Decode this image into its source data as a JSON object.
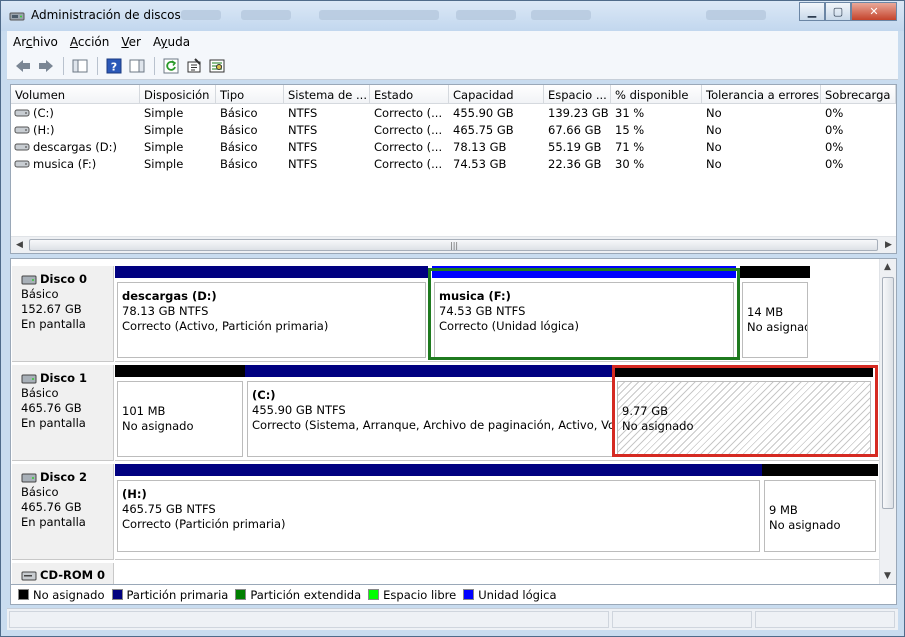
{
  "window": {
    "title": "Administración de discos"
  },
  "menu": [
    {
      "label": "Archivo",
      "accel": "r",
      "pre": "A",
      "post": "chivo"
    },
    {
      "label": "Acción",
      "pre": "",
      "accel": "A",
      "post": "cción"
    },
    {
      "label": "Ver",
      "pre": "",
      "accel": "V",
      "post": "er"
    },
    {
      "label": "Ayuda",
      "pre": "",
      "accel": "A",
      "post": "yuda"
    }
  ],
  "columns": [
    "Volumen",
    "Disposición",
    "Tipo",
    "Sistema de ...",
    "Estado",
    "Capacidad",
    "Espacio ...",
    "% disponible",
    "Tolerancia a errores",
    "Sobrecarga"
  ],
  "volumes": [
    {
      "name": "(C:)",
      "layout": "Simple",
      "type": "Básico",
      "fs": "NTFS",
      "status": "Correcto (...",
      "capacity": "455.90 GB",
      "free": "139.23 GB",
      "pct": "31 %",
      "fault": "No",
      "overhead": "0%"
    },
    {
      "name": "(H:)",
      "layout": "Simple",
      "type": "Básico",
      "fs": "NTFS",
      "status": "Correcto (...",
      "capacity": "465.75 GB",
      "free": "67.66 GB",
      "pct": "15 %",
      "fault": "No",
      "overhead": "0%"
    },
    {
      "name": "descargas (D:)",
      "layout": "Simple",
      "type": "Básico",
      "fs": "NTFS",
      "status": "Correcto (...",
      "capacity": "78.13 GB",
      "free": "55.19 GB",
      "pct": "71 %",
      "fault": "No",
      "overhead": "0%"
    },
    {
      "name": "musica (F:)",
      "layout": "Simple",
      "type": "Básico",
      "fs": "NTFS",
      "status": "Correcto (...",
      "capacity": "74.53 GB",
      "free": "22.36 GB",
      "pct": "30 %",
      "fault": "No",
      "overhead": "0%"
    }
  ],
  "disks": [
    {
      "name": "Disco 0",
      "type": "Básico",
      "size": "152.67 GB",
      "state": "En pantalla",
      "partitions": [
        {
          "title": "descargas  (D:)",
          "line1": "78.13 GB NTFS",
          "line2": "Correcto (Activo, Partición primaria)"
        },
        {
          "title": "musica  (F:)",
          "line1": "74.53 GB NTFS",
          "line2": "Correcto (Unidad lógica)"
        },
        {
          "title": "",
          "line1": "14 MB",
          "line2": "No asignad"
        }
      ]
    },
    {
      "name": "Disco 1",
      "type": "Básico",
      "size": "465.76 GB",
      "state": "En pantalla",
      "partitions": [
        {
          "title": "",
          "line1": "101 MB",
          "line2": "No asignado"
        },
        {
          "title": "(C:)",
          "line1": "455.90 GB NTFS",
          "line2": "Correcto (Sistema, Arranque, Archivo de paginación, Activo, Volcac"
        },
        {
          "title": "",
          "line1": "9.77 GB",
          "line2": "No asignado"
        }
      ]
    },
    {
      "name": "Disco 2",
      "type": "Básico",
      "size": "465.76 GB",
      "state": "En pantalla",
      "partitions": [
        {
          "title": "(H:)",
          "line1": "465.75 GB NTFS",
          "line2": "Correcto (Partición primaria)"
        },
        {
          "title": "",
          "line1": "9 MB",
          "line2": "No asignado"
        }
      ]
    },
    {
      "name": "CD-ROM 0"
    }
  ],
  "legend": [
    {
      "label": "No asignado",
      "color": "#000000"
    },
    {
      "label": "Partición primaria",
      "color": "#00007f"
    },
    {
      "label": "Partición extendida",
      "color": "#007f00"
    },
    {
      "label": "Espacio libre",
      "color": "#00ff00"
    },
    {
      "label": "Unidad lógica",
      "color": "#0000ff"
    }
  ],
  "colors": {
    "unallocated": "#000000",
    "primary": "#000080",
    "logical": "#0000ff",
    "highlight_green": "#1f7a1f",
    "highlight_red": "#d52a22"
  }
}
